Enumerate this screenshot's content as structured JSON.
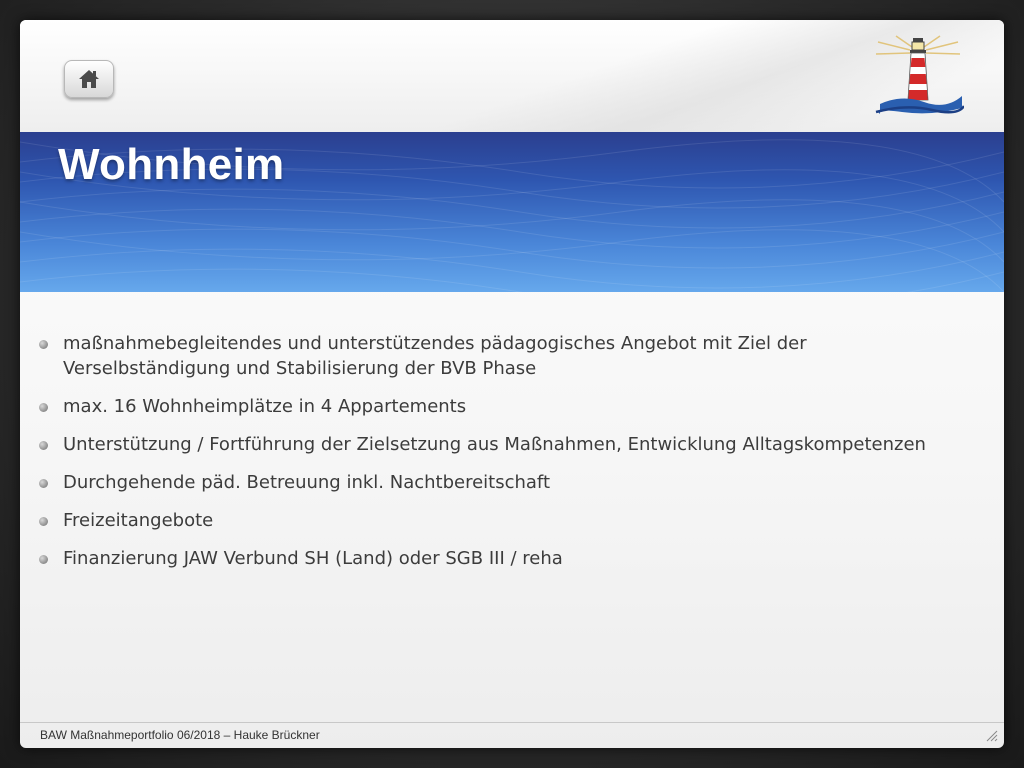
{
  "slide": {
    "title": "Wohnheim",
    "bullets": [
      "maßnahmebegleitendes  und  unterstützendes pädagogisches Angebot mit Ziel der Verselbständigung und Stabilisierung der BVB Phase",
      "max. 16 Wohnheimplätze in 4 Appartements",
      "Unterstützung / Fortführung der Zielsetzung aus Maßnahmen, Entwicklung Alltagskompetenzen",
      "Durchgehende päd. Betreuung inkl. Nachtbereitschaft",
      "Freizeitangebote",
      "Finanzierung JAW Verbund SH (Land)  oder SGB III / reha"
    ],
    "footer": "BAW Maßnahmeportfolio 06/2018 – Hauke Brückner"
  },
  "icons": {
    "home_button": "home-icon",
    "logo": "lighthouse-logo",
    "bullet": "bullet-dot-icon",
    "resize": "resize-grip-icon"
  },
  "colors": {
    "banner_top": "#2b3f8f",
    "banner_bottom": "#66a8ec",
    "title_text": "#ffffff",
    "body_text": "#3c3c3c",
    "lighthouse_red": "#d42a2a"
  }
}
